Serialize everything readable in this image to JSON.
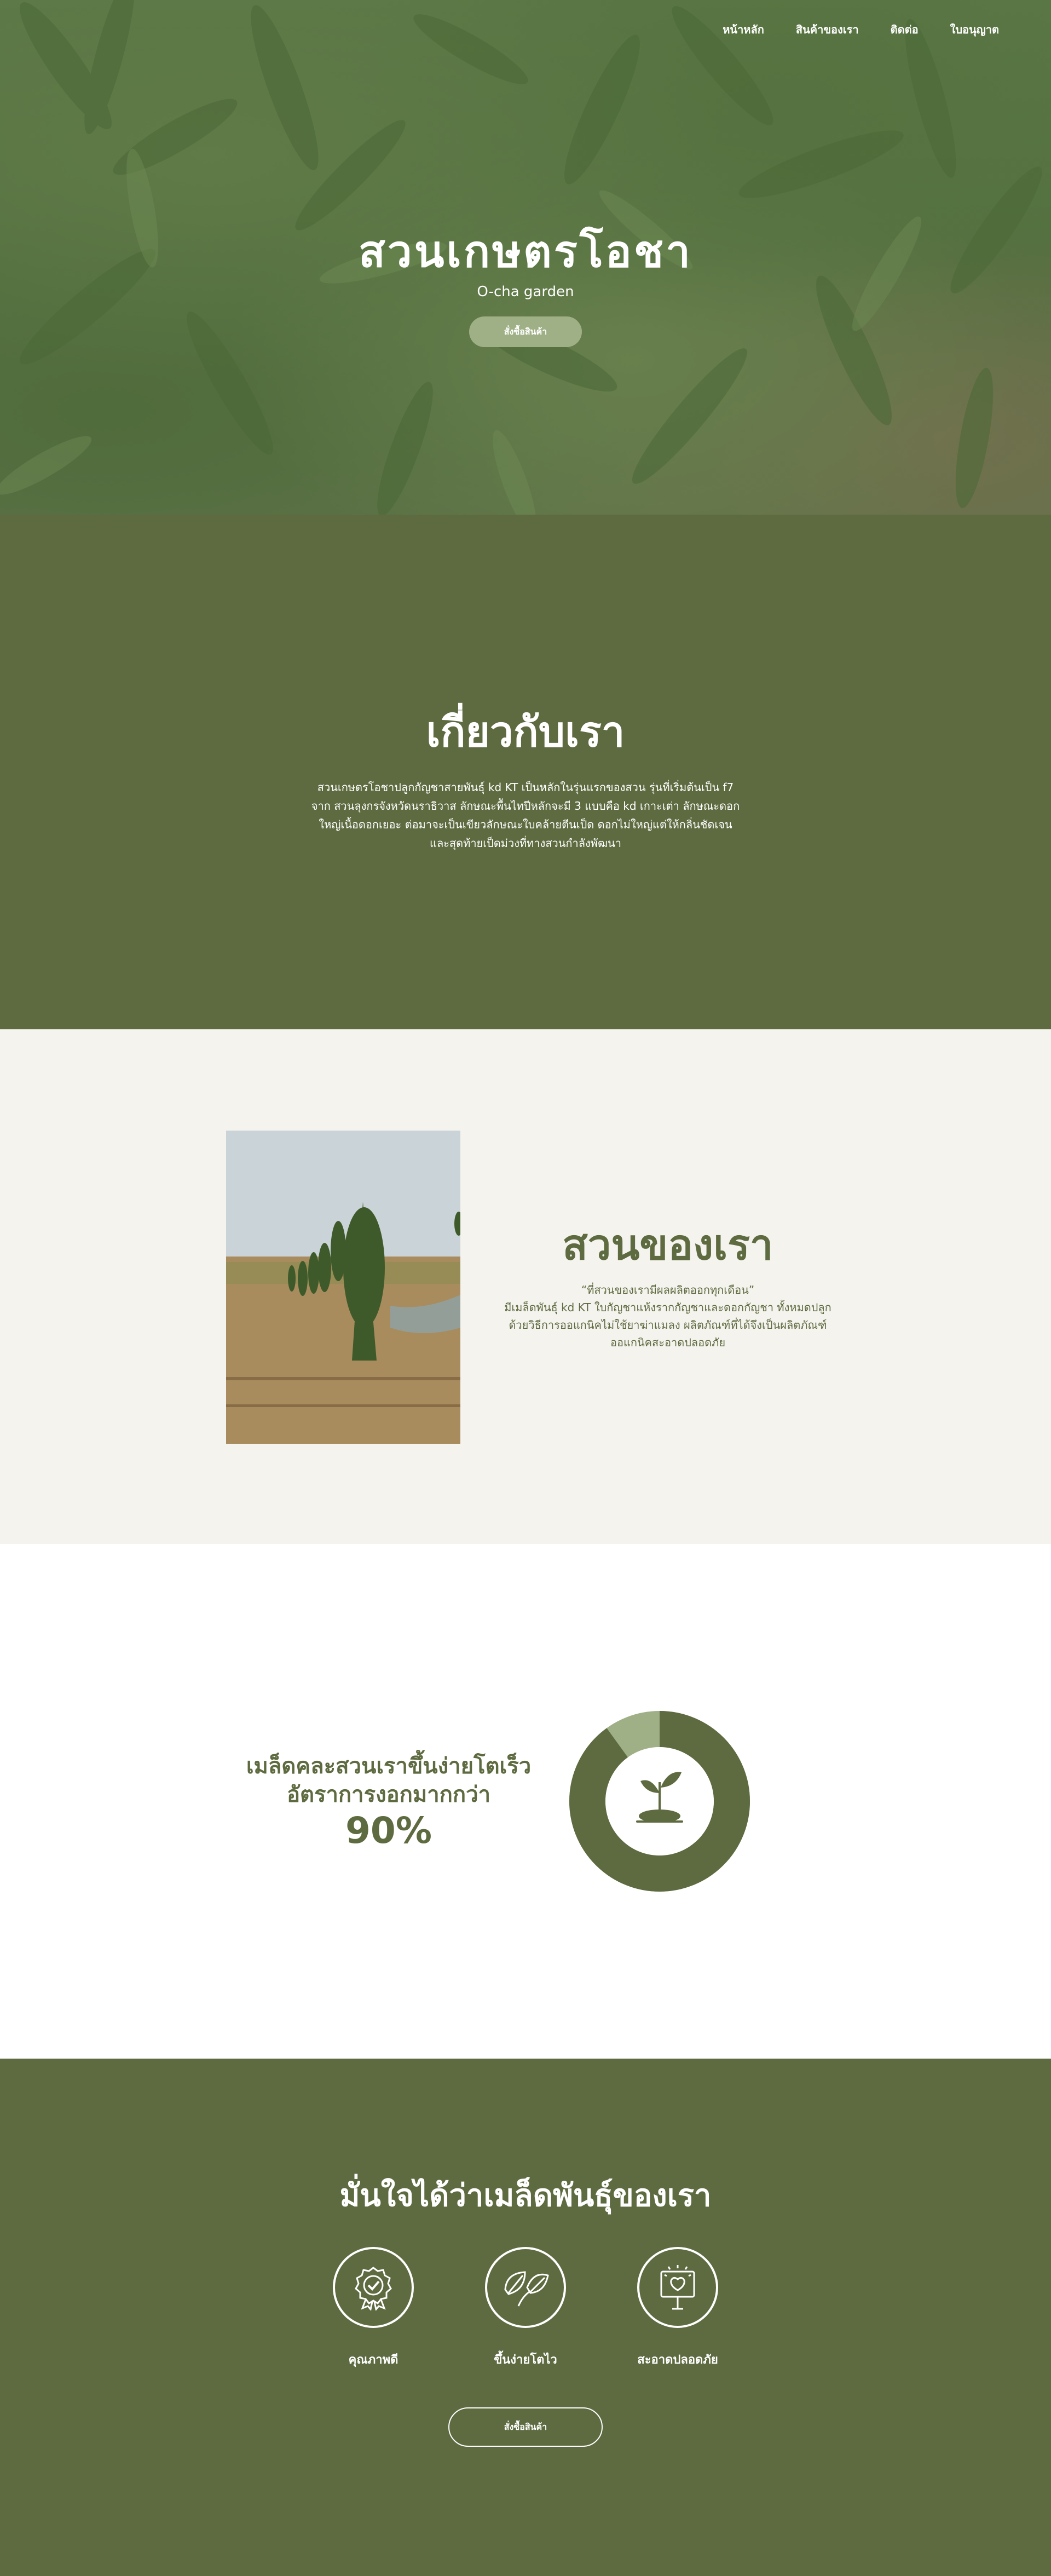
{
  "nav": {
    "items": [
      "หน้าหลัก",
      "สินค้าของเรา",
      "ติดต่อ",
      "ใบอนุญาต"
    ]
  },
  "hero": {
    "title": "สวนเกษตรโอชา",
    "subtitle": "O-cha garden",
    "button": "สั่งซื้อสินค้า"
  },
  "about": {
    "title": "เกี่ยวกับเรา",
    "body": "สวนเกษตรโอชาปลูกกัญชาสายพันธุ์ kd KT เป็นหลักในรุ่นแรกของสวน รุ่นที่เริ่มต้นเป็น f7 จาก สวนลุงกรจังหวัดนราธิวาส ลักษณะพืันไทปีหลักจะมี 3 แบบคือ kd เกาะเต่า ลักษณะดอกใหญ่เนื้อดอกเยอะ ต่อมาจะเป็นเขียวลักษณะใบคล้ายตีนเป็ด ดอกไม่ใหญ่แต่ให้กลิ่นชัดเจน และสุดท้ายเป็ดม่วงที่ทางสวนกำลังพัฒนา"
  },
  "garden": {
    "title": "สวนของเรา",
    "quote": "“ที่สวนของเรามีผลผลิตออกทุกเดือน”",
    "body": "มีเมล็ดพันธุ์ kd KT ใบกัญชาแห้งรากกัญชาและดอกกัญชา ทั้งหมดปลูกด้วยวิธีการออแกนิคไม่ใช้ยาฆ่าแมลง ผลิตภัณฑ์ที่ได้จึงเป็นผลิตภัณฑ์ออแกนิคสะอาดปลอดภัย"
  },
  "germination": {
    "line1": "เมล็ดคละสวนเราขึ้นง่ายโตเร็ว",
    "line2": "อัตราการงอกมากกว่า",
    "percent_label": "90%",
    "percent_value": 90
  },
  "confidence": {
    "title": "มั่นใจได้ว่าเมล็ดพันธุ์ของเรา",
    "features": [
      {
        "label": "คุณภาพดี",
        "icon": "quality-badge-icon"
      },
      {
        "label": "ขึ้นง่ายโตไว",
        "icon": "leaf-icon"
      },
      {
        "label": "สะอาดปลอดภัย",
        "icon": "safety-sign-icon"
      }
    ],
    "button": "สั่งซื้อสินค้า"
  },
  "colors": {
    "olive": "#5e6b40",
    "sage": "#9fb086",
    "cream": "#f4f3ee"
  }
}
